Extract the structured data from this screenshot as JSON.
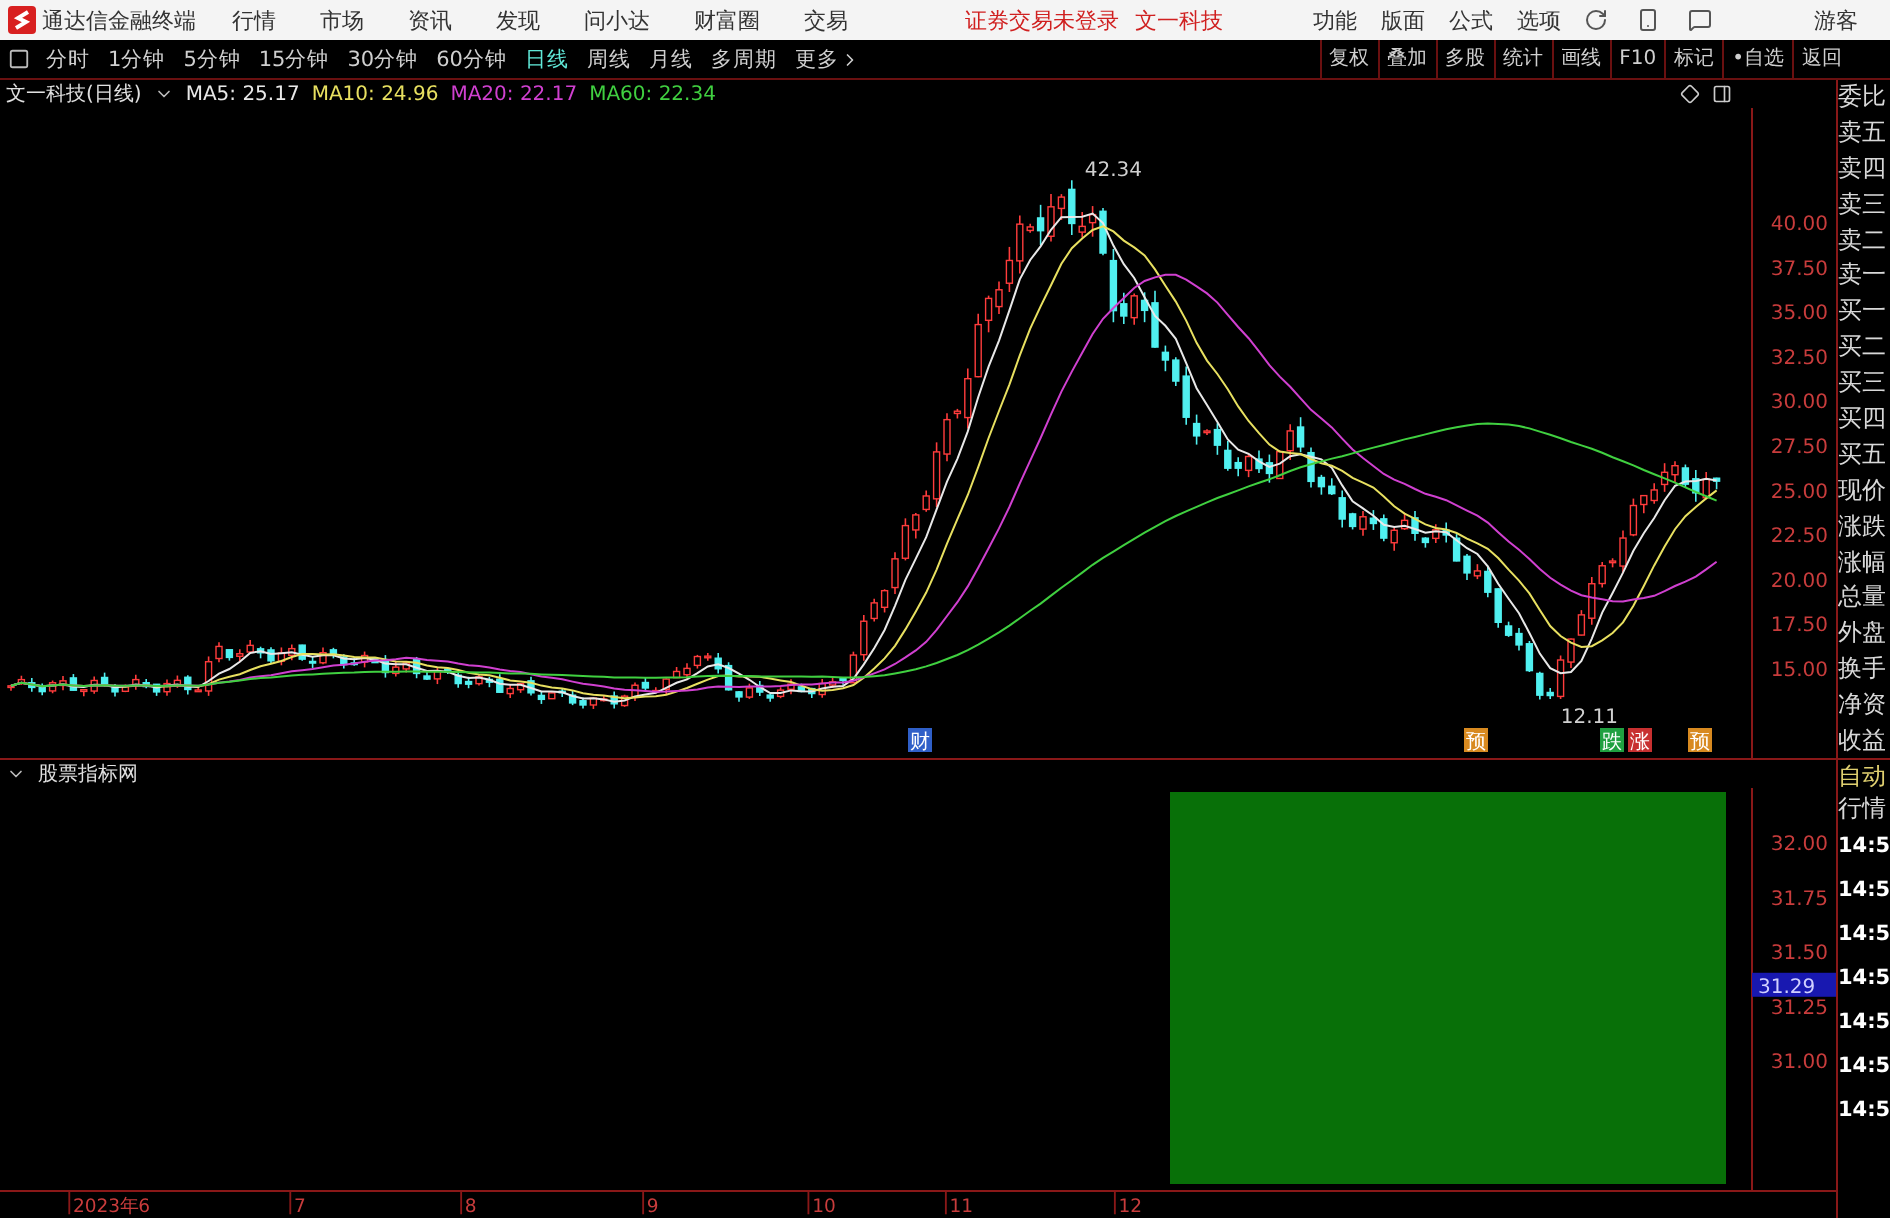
{
  "app": {
    "title": "通达信金融终端"
  },
  "menu": [
    "行情",
    "市场",
    "资讯",
    "发现",
    "问小达",
    "财富圈",
    "交易"
  ],
  "login_status": "证券交易未登录",
  "stock_link": "文一科技",
  "tools": [
    "功能",
    "版面",
    "公式",
    "选项"
  ],
  "user": "游客",
  "periods": [
    {
      "label": "分时",
      "selected": false
    },
    {
      "label": "1分钟",
      "selected": false
    },
    {
      "label": "5分钟",
      "selected": false
    },
    {
      "label": "15分钟",
      "selected": false
    },
    {
      "label": "30分钟",
      "selected": false
    },
    {
      "label": "60分钟",
      "selected": false
    },
    {
      "label": "日线",
      "selected": true
    },
    {
      "label": "周线",
      "selected": false
    },
    {
      "label": "月线",
      "selected": false
    },
    {
      "label": "多周期",
      "selected": false
    }
  ],
  "more_label": "更多",
  "actions": [
    "复权",
    "叠加",
    "多股",
    "统计",
    "画线",
    "F10",
    "标记",
    "•自选",
    "返回"
  ],
  "main_chart": {
    "title": "文一科技(日线)",
    "ma": [
      {
        "label": "MA5: 25.17",
        "color": "#e8e8e8"
      },
      {
        "label": "MA10: 24.96",
        "color": "#e8e060"
      },
      {
        "label": "MA20: 22.17",
        "color": "#d040d0"
      },
      {
        "label": "MA60: 22.34",
        "color": "#40d040"
      }
    ],
    "price_ticks": [
      "40.00",
      "37.50",
      "35.00",
      "32.50",
      "30.00",
      "27.50",
      "25.00",
      "22.50",
      "20.00",
      "17.50",
      "15.00"
    ],
    "high_label": "42.34",
    "low_label": "12.11",
    "event_marks": [
      {
        "label": "财",
        "color": "#2f5fc8"
      },
      {
        "label": "预",
        "color": "#d88a20"
      },
      {
        "label": "跌",
        "color": "#20a040"
      },
      {
        "label": "涨",
        "color": "#c83030"
      },
      {
        "label": "预",
        "color": "#d88a20"
      }
    ]
  },
  "indicator": {
    "title": "股票指标网",
    "ticks": [
      "32.00",
      "31.75",
      "31.50",
      "31.25",
      "31.00"
    ],
    "cursor_value": "31.29"
  },
  "x_axis": [
    "2023年6",
    "7",
    "8",
    "9",
    "10",
    "11",
    "12"
  ],
  "quote_labels": [
    "委比",
    "卖五",
    "卖四",
    "卖三",
    "卖二",
    "卖一",
    "买一",
    "买二",
    "买三",
    "买四",
    "买五",
    "现价",
    "涨跌",
    "涨幅",
    "总量",
    "外盘",
    "换手",
    "净资",
    "收益"
  ],
  "tick_panel": {
    "title_lines": [
      "自动",
      "行情"
    ],
    "times": [
      "14:5",
      "14:5",
      "14:5",
      "14:5",
      "14:5",
      "14:5",
      "14:5"
    ]
  }
}
